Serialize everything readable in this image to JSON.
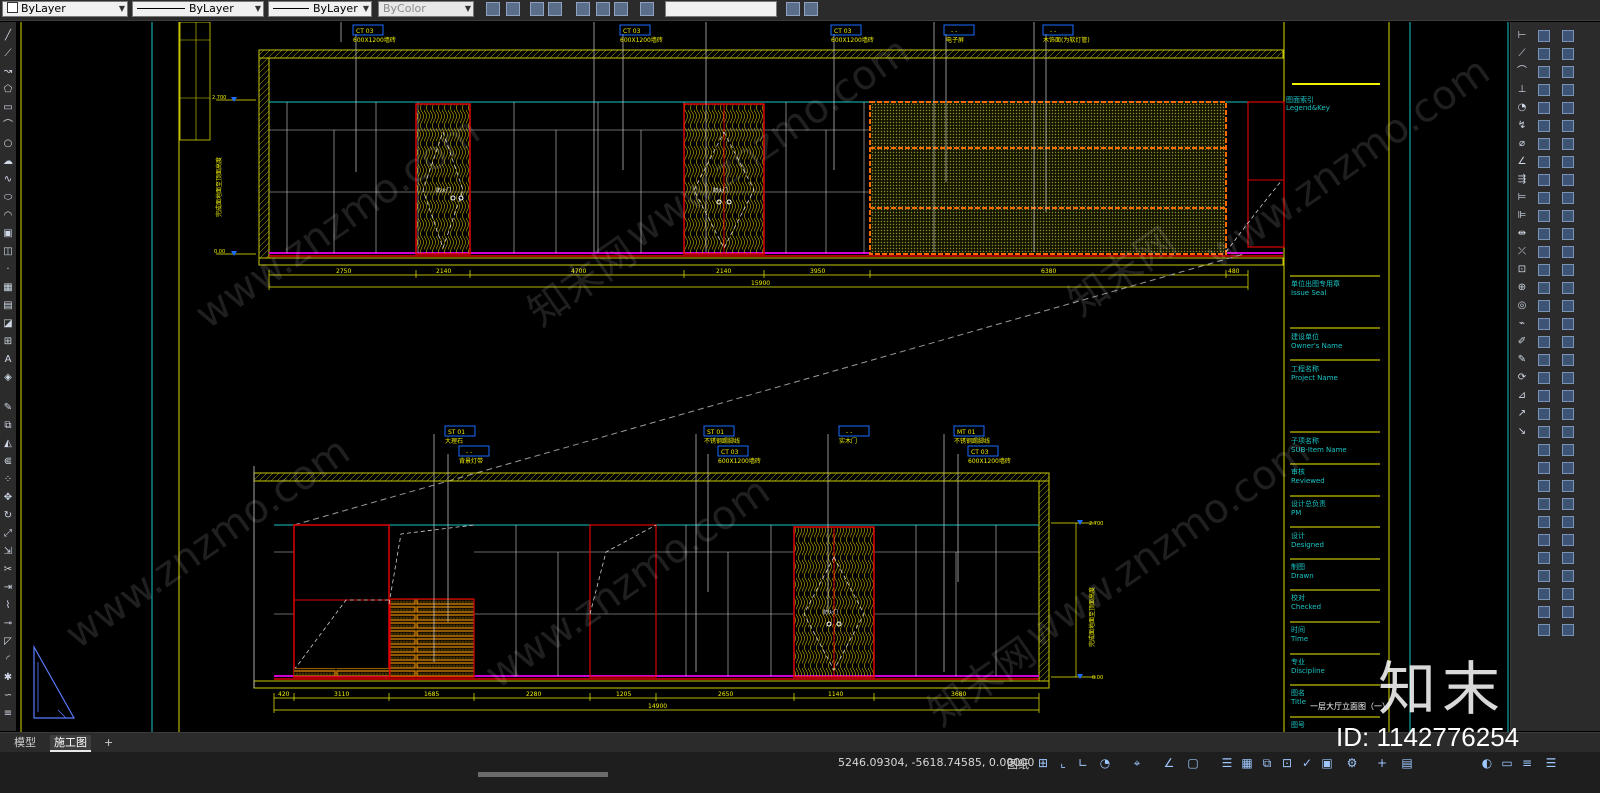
{
  "toolbar": {
    "layer_color": "ByLayer",
    "linetype": "ByLayer",
    "lineweight": "ByLayer",
    "plotstyle": "ByColor"
  },
  "tabs": {
    "model": "模型",
    "layout": "施工图",
    "add": "+"
  },
  "status": {
    "coordinates": "5246.09304, -5618.74585, 0.00000",
    "space": "图纸"
  },
  "title_block": {
    "legend": "图面索引",
    "legend_en": "Legend&Key",
    "issue_seal": "单位出图专用章",
    "issue_seal_en": "Issue Seal",
    "owner": "建设单位",
    "owner_en": "Owner's Name",
    "project": "工程名称",
    "project_en": "Project Name",
    "sub_item": "子项名称",
    "sub_item_en": "SUB-Item Name",
    "reviewed": "审核",
    "reviewed_en": "Reviewed",
    "pm": "设计总负责",
    "pm_en": "PM",
    "designed": "设计",
    "designed_en": "Designed",
    "drawn": "制图",
    "drawn_en": "Drawn",
    "checked": "校对",
    "checked_en": "Checked",
    "time": "时间",
    "time_en": "Time",
    "discipline": "专业",
    "discipline_en": "Discipline",
    "title": "图名",
    "title_en": "Title",
    "title_value": "一层大厅立面图（一）",
    "drawing_no": "图号"
  },
  "top_elevation": {
    "tags": [
      {
        "code": "CT  03",
        "text": "600X1200墙砖"
      },
      {
        "code": "CT  03",
        "text": "600X1200墙砖"
      },
      {
        "code": "CT  03",
        "text": "600X1200墙砖"
      },
      {
        "code": "-  -",
        "text": "电子屏"
      },
      {
        "code": "-  -",
        "text": "木饰面(为软灯管)"
      }
    ],
    "dims": [
      "2750",
      "2140",
      "4700",
      "2140",
      "3950",
      "6380",
      "480"
    ],
    "total": "15900",
    "levels": [
      "2.700",
      "0.00"
    ],
    "side_text": "完成面地面至顶面高度",
    "door_label": "防火门"
  },
  "bottom_elevation": {
    "tags": [
      {
        "code": "ST  01",
        "text": "大理石"
      },
      {
        "code": "-  -",
        "text": "背景灯带"
      },
      {
        "code": "ST  01",
        "text": "不锈钢踢脚线"
      },
      {
        "code": "CT  03",
        "text": "600X1200墙砖"
      },
      {
        "code": "-  -",
        "text": "实木门"
      },
      {
        "code": "MT  01",
        "text": "不锈钢踢脚线"
      },
      {
        "code": "CT  03",
        "text": "600X1200墙砖"
      }
    ],
    "dims": [
      "420",
      "3110",
      "1685",
      "2280",
      "1205",
      "2650",
      "1140",
      "3680"
    ],
    "total": "14900",
    "levels": [
      "2.700",
      "0.00"
    ],
    "side_text": "完成面地面至顶面高度",
    "door_label": "防火门"
  },
  "watermarks": {
    "brand": "知末",
    "id": "ID: 1142776254",
    "site": "www.znzmo.com",
    "site_cn": "知末网"
  }
}
